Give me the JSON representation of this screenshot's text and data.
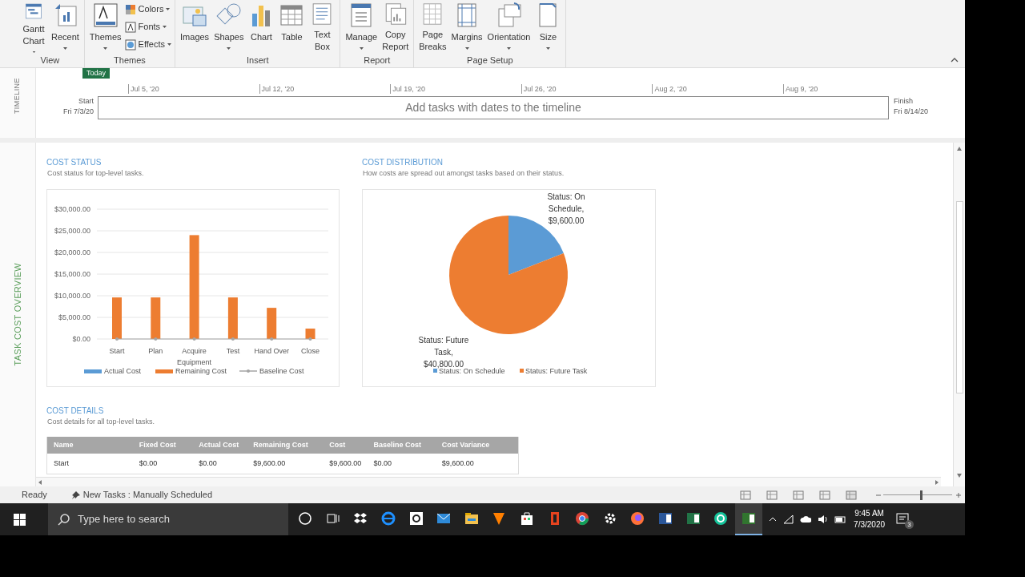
{
  "ribbon": {
    "groups": [
      {
        "label": "View",
        "buttons": [
          {
            "label": "Gantt\nChart",
            "dropdown": true
          },
          {
            "label": "Recent",
            "dropdown": true
          }
        ]
      },
      {
        "label": "Themes",
        "buttons": [
          {
            "label": "Themes",
            "dropdown": true
          }
        ],
        "small_buttons": [
          {
            "label": "Colors",
            "dropdown": true
          },
          {
            "label": "Fonts",
            "dropdown": true
          },
          {
            "label": "Effects",
            "dropdown": true
          }
        ]
      },
      {
        "label": "Insert",
        "buttons": [
          {
            "label": "Images",
            "dropdown": false
          },
          {
            "label": "Shapes",
            "dropdown": true
          },
          {
            "label": "Chart",
            "dropdown": false
          },
          {
            "label": "Table",
            "dropdown": false
          },
          {
            "label": "Text\nBox",
            "dropdown": false
          }
        ]
      },
      {
        "label": "Report",
        "buttons": [
          {
            "label": "Manage",
            "dropdown": true
          },
          {
            "label": "Copy\nReport",
            "dropdown": false
          }
        ]
      },
      {
        "label": "Page Setup",
        "buttons": [
          {
            "label": "Page\nBreaks",
            "dropdown": false
          },
          {
            "label": "Margins",
            "dropdown": true
          },
          {
            "label": "Orientation",
            "dropdown": true
          },
          {
            "label": "Size",
            "dropdown": true
          }
        ]
      }
    ]
  },
  "timeline": {
    "side_label": "TIMELINE",
    "today": "Today",
    "dates": [
      "Jul 5, '20",
      "Jul 12, '20",
      "Jul 19, '20",
      "Jul 26, '20",
      "Aug 2, '20",
      "Aug 9, '20"
    ],
    "start_label": "Start",
    "start_date": "Fri 7/3/20",
    "placeholder": "Add tasks with dates to the timeline",
    "finish_label": "Finish",
    "finish_date": "Fri 8/14/20"
  },
  "report": {
    "side_label": "TASK COST OVERVIEW",
    "cost_status": {
      "title": "COST STATUS",
      "subtitle": "Cost status for top-level tasks.",
      "chart_data": {
        "type": "bar",
        "categories": [
          "Start",
          "Plan",
          "Acquire Equipment",
          "Test",
          "Hand Over",
          "Close"
        ],
        "series": [
          {
            "name": "Actual Cost",
            "color": "#5b9bd5",
            "values": [
              0,
              0,
              0,
              0,
              0,
              0
            ]
          },
          {
            "name": "Remaining Cost",
            "color": "#ed7d31",
            "values": [
              9600,
              9600,
              24000,
              9600,
              7200,
              2400
            ]
          },
          {
            "name": "Baseline Cost",
            "color": "#a5a5a5",
            "values": [
              0,
              0,
              0,
              0,
              0,
              0
            ]
          }
        ],
        "ylim": [
          0,
          30000
        ],
        "grid": true,
        "legend": "bottom",
        "yticks": [
          {
            "value": 0,
            "label": "$0.00"
          },
          {
            "value": 5000,
            "label": "$5,000.00"
          },
          {
            "value": 10000,
            "label": "$10,000.00"
          },
          {
            "value": 15000,
            "label": "$15,000.00"
          },
          {
            "value": 20000,
            "label": "$20,000.00"
          },
          {
            "value": 25000,
            "label": "$25,000.00"
          },
          {
            "value": 30000,
            "label": "$30,000.00"
          }
        ]
      }
    },
    "cost_distribution": {
      "title": "COST DISTRIBUTION",
      "subtitle": "How costs are spread out amongst tasks based on their status.",
      "chart_data": {
        "type": "pie",
        "categories": [
          "Status: On Schedule",
          "Status: Future Task"
        ],
        "values": [
          9600,
          40800
        ],
        "colors": [
          "#5b9bd5",
          "#ed7d31"
        ],
        "value_labels": [
          "Status: On Schedule, $9,600.00",
          "Status: Future Task, $40,800.00"
        ],
        "legend": "bottom"
      }
    },
    "cost_details": {
      "title": "COST DETAILS",
      "subtitle": "Cost details for all top-level tasks.",
      "columns": [
        "Name",
        "Fixed Cost",
        "Actual Cost",
        "Remaining Cost",
        "Cost",
        "Baseline Cost",
        "Cost Variance"
      ],
      "rows": [
        [
          "Start",
          "$0.00",
          "$0.00",
          "$9,600.00",
          "$9,600.00",
          "$0.00",
          "$9,600.00"
        ]
      ]
    }
  },
  "status_bar": {
    "status": "Ready",
    "new_tasks": "New Tasks : Manually Scheduled",
    "zoom": {
      "level": 0.55
    }
  },
  "taskbar": {
    "search_placeholder": "Type here to search",
    "apps": [
      {
        "selected": false
      },
      {
        "selected": false
      },
      {
        "selected": false
      },
      {
        "selected": false
      },
      {
        "selected": false
      },
      {
        "selected": false
      },
      {
        "selected": false
      },
      {
        "selected": false
      },
      {
        "selected": false
      },
      {
        "selected": false
      },
      {
        "selected": false
      },
      {
        "selected": false
      },
      {
        "selected": false
      },
      {
        "selected": false
      },
      {
        "selected": false
      },
      {
        "selected": false
      },
      {
        "selected": true
      }
    ],
    "time": "9:45 AM",
    "date": "7/3/2020",
    "notification_count": "3"
  }
}
